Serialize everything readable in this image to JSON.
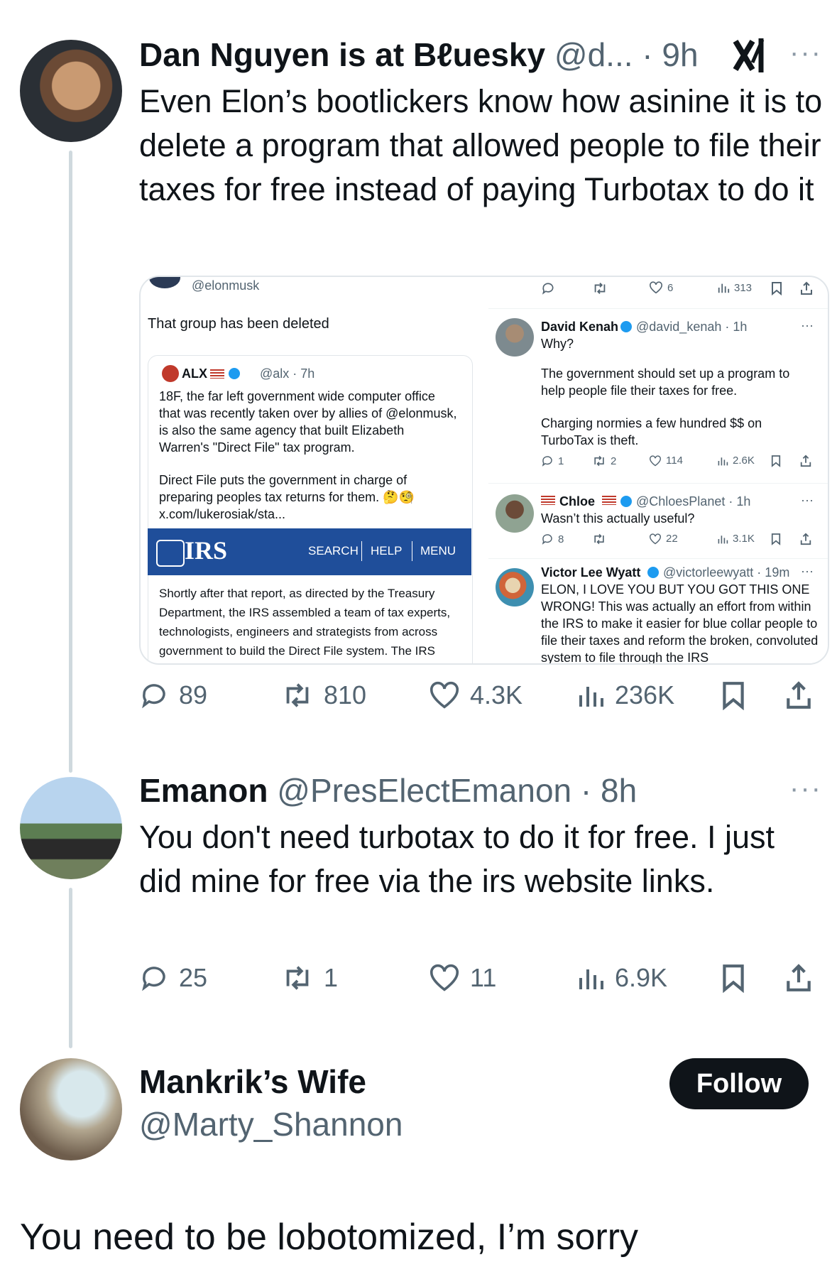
{
  "tweet1": {
    "author": "Dan Nguyen is at Bℓuesky",
    "handle_time": "@d... · 9h",
    "more": "···",
    "text": "Even Elon’s bootlickers know how asinine it is to delete a program that allowed people to file their taxes for free instead of paying Turbotax to do it",
    "replies": "89",
    "reposts": "810",
    "likes": "4.3K",
    "views": "236K"
  },
  "embed": {
    "top_handle": "@elonmusk",
    "deleted_text": "That group has been deleted",
    "quote": {
      "name": "ALX",
      "meta": "@alx · 7h",
      "para1": "18F, the far left government wide computer office that was recently taken over by allies of @elonmusk, is also the same agency that built Elizabeth Warren's \"Direct File\" tax program.",
      "para2": "Direct File puts the government in charge of preparing peoples tax returns for them. 🤔🧐",
      "link": "x.com/lukerosiak/sta..."
    },
    "irs": {
      "logo": "IRS",
      "search": "SEARCH",
      "help": "HELP",
      "menu": "MENU",
      "article": "Shortly after that report, as directed by the Treasury Department, the IRS assembled a team of tax experts, technologists, engineers and strategists from across government to build the Direct File system. The IRS"
    },
    "top_bar": {
      "likes": "6",
      "views": "313"
    },
    "reply1": {
      "name": "David Kenah",
      "meta": "@david_kenah · 1h",
      "line1": "Why?",
      "line2": "The government should set up a program to help people file their taxes for free.",
      "line3": "Charging normies a few hundred $$ on TurboTax is theft.",
      "replies": "1",
      "reposts": "2",
      "likes": "114",
      "views": "2.6K"
    },
    "reply2": {
      "name": "Chloe",
      "meta": "@ChloesPlanet · 1h",
      "text": "Wasn’t this actually useful?",
      "replies": "8",
      "likes": "22",
      "views": "3.1K"
    },
    "reply3": {
      "name": "Victor Lee Wyatt",
      "meta": "@victorleewyatt · 19m",
      "text": "ELON, I LOVE YOU BUT YOU GOT THIS ONE WRONG! This was actually an effort from within the IRS to make it easier for blue collar people to file their taxes and reform the broken, convoluted system to file through the IRS"
    }
  },
  "tweet2": {
    "author": "Emanon",
    "handle_time": "@PresElectEmanon · 8h",
    "more": "···",
    "text": "You don't need turbotax to do it for free.  I just did mine for free via the irs website links.",
    "replies": "25",
    "reposts": "1",
    "likes": "11",
    "views": "6.9K"
  },
  "tweet3": {
    "author": "Mankrik’s Wife",
    "handle": "@Marty_Shannon",
    "follow": "Follow",
    "text": "You need to be lobotomized, I’m sorry"
  },
  "colors": {
    "text": "#0f1419",
    "muted": "#536471",
    "verified": "#1d9bf0",
    "irs_blue": "#1f4e9a"
  }
}
